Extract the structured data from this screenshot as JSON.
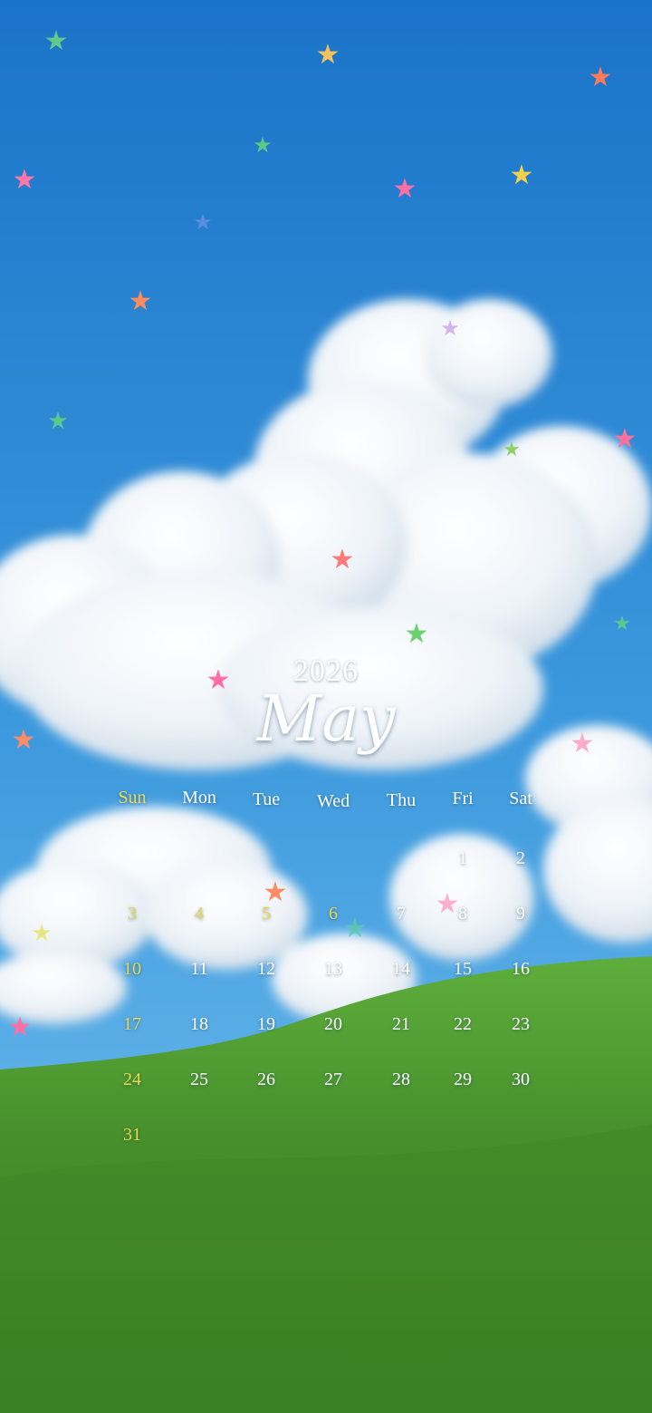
{
  "year": "2026",
  "month": "May",
  "weekdays": [
    "Sun",
    "Mon",
    "Tue",
    "Wed",
    "Thu",
    "Fri",
    "Sat"
  ],
  "colors": {
    "sunday_highlight": "#e9d84a",
    "day_text": "#ffffff",
    "sky_top": "#1f7fd0",
    "grass": "#4a9a2e"
  },
  "weeks": [
    [
      "",
      "",
      "",
      "",
      "",
      "1",
      "2"
    ],
    [
      "3",
      "4",
      "5",
      "6",
      "7",
      "8",
      "9"
    ],
    [
      "10",
      "11",
      "12",
      "13",
      "14",
      "15",
      "16"
    ],
    [
      "17",
      "18",
      "19",
      "20",
      "21",
      "22",
      "23"
    ],
    [
      "24",
      "25",
      "26",
      "27",
      "28",
      "29",
      "30"
    ],
    [
      "31",
      "",
      "",
      "",
      "",
      "",
      ""
    ]
  ],
  "highlighted_days": [
    "3",
    "4",
    "5",
    "6",
    "10",
    "17",
    "24",
    "31"
  ]
}
